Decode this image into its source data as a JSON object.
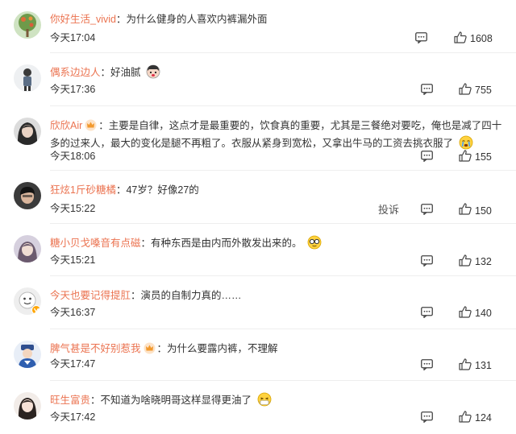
{
  "comments": [
    {
      "user": "你好生活_vivid",
      "text": "为什么健身的人喜欢内裤漏外面",
      "time": "今天17:04",
      "likes": "1608"
    },
    {
      "user": "偶系边边人",
      "text": "好油腻",
      "time": "今天17:36",
      "likes": "755",
      "emoji": "face-emoji"
    },
    {
      "user": "欣欣Air",
      "text": "主要是自律，这点才是最重要的，饮食真的重要，尤其是三餐绝对要吃，俺也是减了四十多的过来人，最大的变化是腿不再粗了。衣服从紧身到宽松，又拿出牛马的工资去挑衣服了",
      "time": "今天18:06",
      "likes": "155",
      "badge": "crown-icon",
      "emoji": "cry-emoji"
    },
    {
      "user": "狂炫1斤砂糖橘",
      "text": "47岁？好像27的",
      "time": "今天15:22",
      "likes": "150",
      "report": "投诉"
    },
    {
      "user": "糖小贝戈嗓音有点磁",
      "text": "有种东西是由内而外散发出来的。",
      "time": "今天15:21",
      "likes": "132",
      "emoji": "glasses-emoji"
    },
    {
      "user": "今天也要记得提肛",
      "text": "演员的自制力真的……",
      "time": "今天16:37",
      "likes": "140"
    },
    {
      "user": "脾气甚是不好别惹我",
      "text": "为什么要露内裤，不理解",
      "time": "今天17:47",
      "likes": "131",
      "badge": "crown-icon"
    },
    {
      "user": "旺生富贵",
      "text": "不知道为啥晓明哥这样显得更油了",
      "time": "今天17:42",
      "likes": "124",
      "emoji": "sick-emoji"
    }
  ],
  "colors": {
    "username": "#eb7350",
    "text": "#333333",
    "divider": "#eeeeee"
  }
}
